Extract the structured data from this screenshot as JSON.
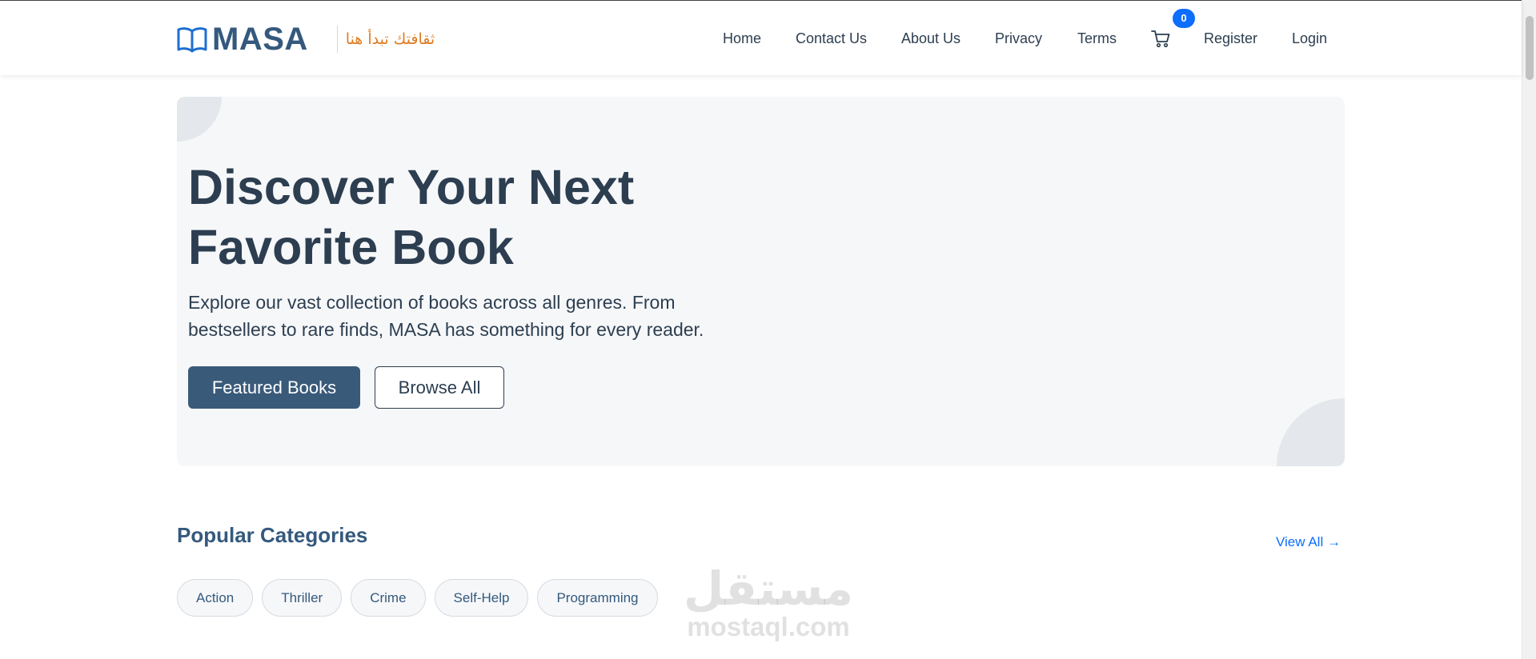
{
  "navbar": {
    "brand_name": "MASA",
    "tagline": "ثقافتك تبدأ هنا",
    "links": [
      "Home",
      "Contact Us",
      "About Us",
      "Privacy",
      "Terms",
      "Register",
      "Login"
    ],
    "cart_count": "0",
    "cart_icon": "cart-icon",
    "brand_icon": "book-icon"
  },
  "hero": {
    "title": "Discover Your Next Favorite Book",
    "description": "Explore our vast collection of books across all genres. From bestsellers to rare finds, MASA has something for every reader.",
    "primary_button": "Featured Books",
    "secondary_button": "Browse All"
  },
  "categories": {
    "title": "Popular Categories",
    "view_all": "View All →",
    "items": [
      "Action",
      "Thriller",
      "Crime",
      "Self-Help",
      "Programming"
    ]
  },
  "watermark": {
    "arabic": "مستقل",
    "latin": "mostaql.com"
  },
  "colors": {
    "brand": "#34597d",
    "accent_orange": "#e07b20",
    "link_blue": "#0d6efd",
    "primary_button": "#3a5a7a",
    "hero_bg": "#f6f7f9"
  }
}
